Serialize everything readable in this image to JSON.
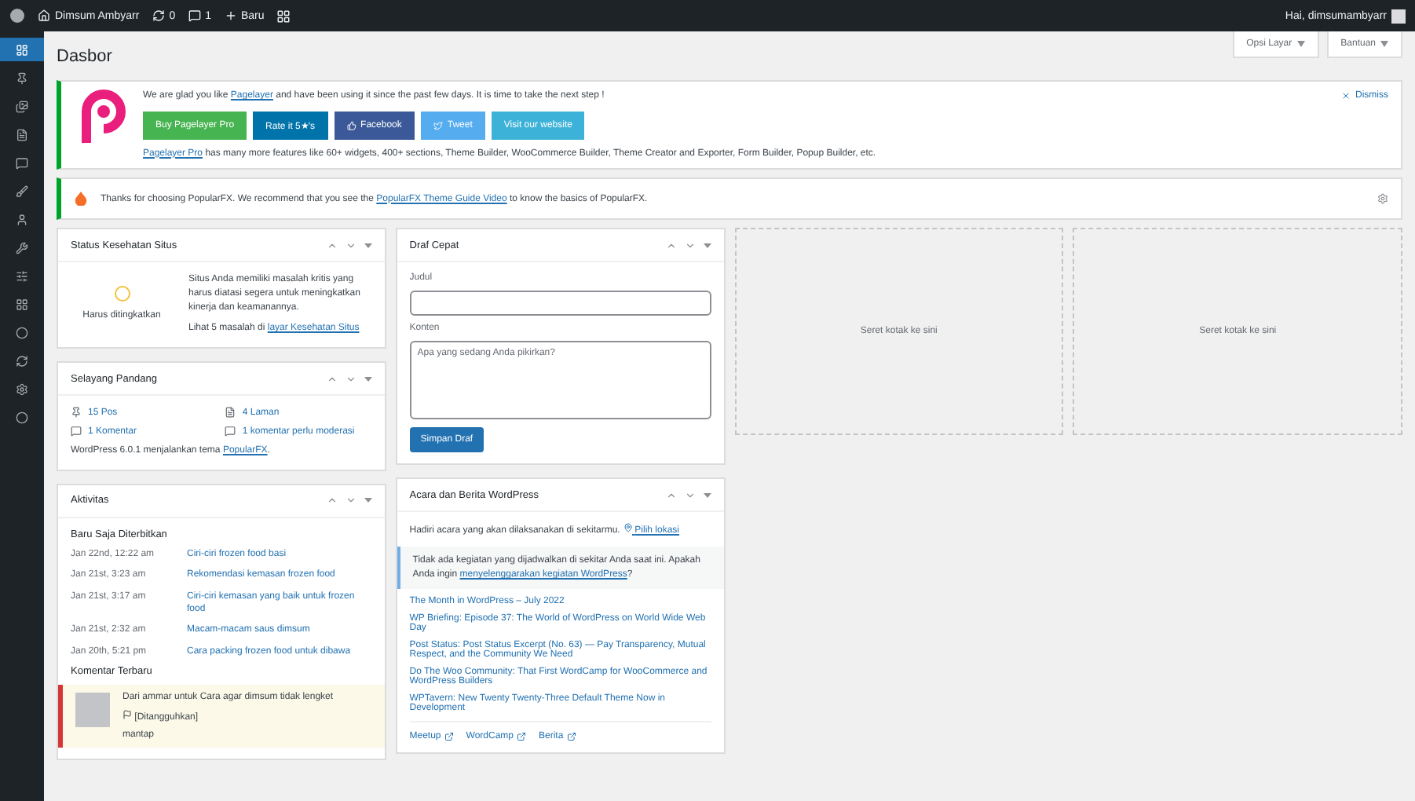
{
  "admin_bar": {
    "site_name": "Dimsum Ambyarr",
    "updates": "0",
    "comments": "1",
    "new_label": "Baru",
    "greeting": "Hai, dimsumambyarr"
  },
  "sidebar": {
    "items": [
      {
        "selected": true
      },
      {
        "selected": false
      },
      {
        "selected": false
      },
      {
        "selected": false
      },
      {
        "selected": false
      },
      {
        "selected": false
      },
      {
        "selected": false
      },
      {
        "selected": false
      },
      {
        "selected": false
      },
      {
        "selected": false
      },
      {
        "selected": false
      },
      {
        "selected": false
      },
      {
        "selected": false
      },
      {
        "selected": false
      }
    ]
  },
  "page_title": "Dasbor",
  "screen_buttons": [
    "Opsi Layar",
    "Bantuan"
  ],
  "pagelayer_notice": {
    "link": "Pagelayer",
    "message_rest": " and have been using it since the past few days. It is time to take the next step !",
    "message_lead": "We are glad you like ",
    "buttons": [
      {
        "label": "Buy Pagelayer Pro",
        "kind": "buy"
      },
      {
        "label": "Rate it 5★'s",
        "kind": "rate"
      },
      {
        "label": "Facebook",
        "kind": "facebook"
      },
      {
        "label": "Tweet",
        "kind": "tweet"
      },
      {
        "label": "Visit our website",
        "kind": "visit"
      }
    ],
    "pro_link": "Pagelayer Pro",
    "pro_text": " has many more features like 60+ widgets, 400+ sections, Theme Builder, WooCommerce Builder, Theme Creator and Exporter, Form Builder, Popup Builder, etc.",
    "dismiss": "Dismiss"
  },
  "popularfx_notice": {
    "lead": "Thanks for choosing PopularFX. We recommend that you see the ",
    "link": "PopularFX Theme Guide Video",
    "rest": " to know the basics of PopularFX."
  },
  "site_health": {
    "title": "Status Kesehatan Situs",
    "status": "Harus ditingkatkan",
    "description": "Situs Anda memiliki masalah kritis yang harus diatasi segera untuk meningkatkan kinerja dan keamanannya.",
    "issues_lead": "Lihat 5 masalah di ",
    "issues_link": "layar Kesehatan Situs"
  },
  "at_a_glance": {
    "title": "Selayang Pandang",
    "items": [
      {
        "label": "15 Pos"
      },
      {
        "label": "4 Laman"
      },
      {
        "label": "1 Komentar"
      },
      {
        "label": "1 komentar perlu moderasi"
      }
    ],
    "footer_lead": "WordPress 6.0.1 menjalankan tema ",
    "footer_link": "PopularFX",
    "footer_end": "."
  },
  "activity": {
    "title": "Aktivitas",
    "published_heading": "Baru Saja Diterbitkan",
    "posts": [
      {
        "date": "Jan 22nd, 12:22 am",
        "title": "Ciri-ciri frozen food basi"
      },
      {
        "date": "Jan 21st, 3:23 am",
        "title": "Rekomendasi kemasan frozen food"
      },
      {
        "date": "Jan 21st, 3:17 am",
        "title": "Ciri-ciri kemasan yang baik untuk frozen food"
      },
      {
        "date": "Jan 21st, 2:32 am",
        "title": "Macam-macam saus dimsum"
      },
      {
        "date": "Jan 20th, 5:21 pm",
        "title": "Cara packing frozen food untuk dibawa"
      }
    ],
    "comments_heading": "Komentar Terbaru",
    "comment": {
      "meta": "Dari ammar untuk Cara agar dimsum tidak lengket",
      "status": "[Ditangguhkan]",
      "text": "mantap"
    }
  },
  "quick_draft": {
    "title": "Draf Cepat",
    "title_label": "Judul",
    "content_label": "Konten",
    "placeholder": "Apa yang sedang Anda pikirkan?",
    "save": "Simpan Draf"
  },
  "events": {
    "title": "Acara dan Berita WordPress",
    "intro": "Hadiri acara yang akan dilaksanakan di sekitarmu.",
    "location": "Pilih lokasi",
    "notice_lead": "Tidak ada kegiatan yang dijadwalkan di sekitar Anda saat ini. Apakah Anda ingin ",
    "notice_link": "menyelenggarakan kegiatan WordPress",
    "notice_end": "?",
    "news": [
      "The Month in WordPress – July 2022",
      "WP Briefing: Episode 37: The World of WordPress on World Wide Web Day",
      "Post Status: Post Status Excerpt (No. 63) — Pay Transparency, Mutual Respect, and the Community We Need",
      "Do The Woo Community: That First WordCamp for WooCommerce and WordPress Builders",
      "WPTavern: New Twenty Twenty-Three Default Theme Now in Development"
    ],
    "footer_links": [
      "Meetup",
      "WordCamp",
      "Berita"
    ]
  },
  "drop_zones": [
    "Seret kotak ke sini",
    "Seret kotak ke sini"
  ]
}
